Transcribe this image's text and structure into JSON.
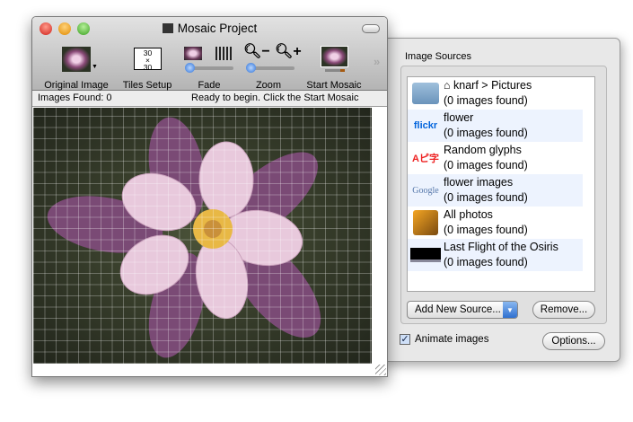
{
  "window": {
    "title": "Mosaic Project"
  },
  "toolbar": {
    "original_image": "Original Image",
    "tiles_setup": "Tiles Setup",
    "tiles_value": "30\n×\n30",
    "fade": "Fade",
    "zoom": "Zoom",
    "start_mosaic": "Start Mosaic",
    "fade_value": 0,
    "zoom_value": 0
  },
  "status": {
    "left": "Images Found: 0",
    "right": "Ready to begin.  Click the Start Mosaic"
  },
  "drawer": {
    "title": "Image Sources",
    "sources": [
      {
        "name": "knarf > Pictures",
        "count": "(0 images found)",
        "icon": "folder-icon"
      },
      {
        "name": "flower",
        "count": "(0 images found)",
        "icon": "flickr-icon",
        "icon_text": "flickr"
      },
      {
        "name": "Random glyphs",
        "count": "(0 images found)",
        "icon": "glyphs-icon",
        "icon_text": "Aピ字"
      },
      {
        "name": "flower images",
        "count": "(0 images found)",
        "icon": "google-icon",
        "icon_text": "Google"
      },
      {
        "name": "All photos",
        "count": "(0 images found)",
        "icon": "iphoto-icon"
      },
      {
        "name": "Last Flight of the Osiris",
        "count": "(0 images found)",
        "icon": "movie-icon"
      }
    ],
    "add_source": "Add New Source...",
    "remove": "Remove...",
    "animate": "Animate images",
    "animate_checked": true,
    "options": "Options..."
  }
}
